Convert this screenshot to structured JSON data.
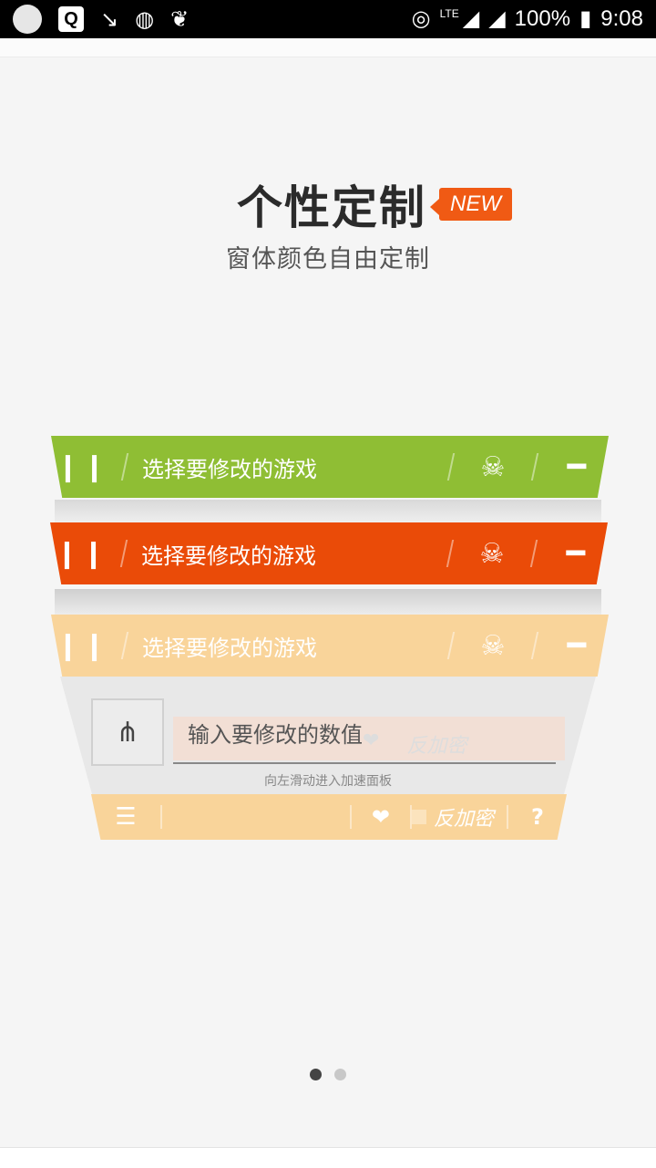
{
  "status_bar": {
    "battery": "100%",
    "time": "9:08",
    "network_type": "LTE",
    "icons": [
      "circle-icon",
      "q-app-icon",
      "check-arrow-icon",
      "loading-icon",
      "leaf-icon",
      "hotspot-icon",
      "signal-icon",
      "battery-icon"
    ]
  },
  "heading": {
    "title": "个性定制",
    "badge": "NEW",
    "subtitle": "窗体颜色自由定制"
  },
  "bars": [
    {
      "label": "选择要修改的游戏",
      "color": "#8fbe34"
    },
    {
      "label": "选择要修改的游戏",
      "color": "#ea4b08"
    },
    {
      "label": "选择要修改的游戏",
      "color": "#f9d49a"
    }
  ],
  "panel": {
    "input_placeholder": "输入要修改的数值",
    "hint": "向左滑动进入加速面板",
    "faded_option": "反加密"
  },
  "bottom_bar": {
    "option_label": "反加密",
    "help": "?"
  },
  "pagination": {
    "current": 1,
    "total": 2
  }
}
